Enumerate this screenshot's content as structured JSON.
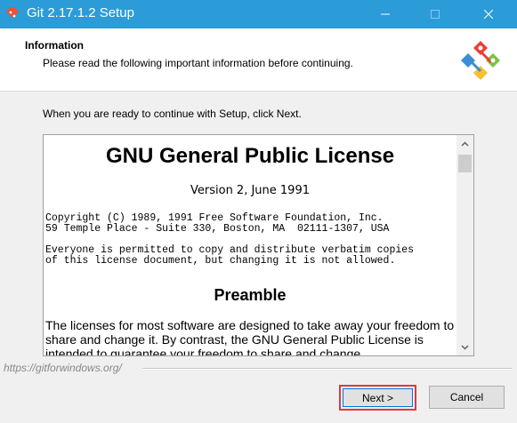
{
  "window": {
    "title": "Git 2.17.1.2 Setup"
  },
  "header": {
    "title": "Information",
    "subtitle": "Please read the following important information before continuing."
  },
  "intro": "When you are ready to continue with Setup, click Next.",
  "license": {
    "title": "GNU General Public License",
    "version": "Version 2, June 1991",
    "copyright_lines": [
      "Copyright (C) 1989, 1991 Free Software Foundation, Inc.",
      "59 Temple Place - Suite 330, Boston, MA  02111-1307, USA"
    ],
    "permission_lines": [
      "Everyone is permitted to copy and distribute verbatim copies",
      "of this license document, but changing it is not allowed."
    ],
    "preamble_heading": "Preamble",
    "preamble_text": "  The licenses for most software are designed to take away your freedom to share and change it. By contrast, the GNU General Public License is intended to guarantee your freedom to share and change"
  },
  "footer": {
    "link": "https://gitforwindows.org/"
  },
  "buttons": {
    "next": "Next >",
    "cancel": "Cancel"
  },
  "icons": {
    "app": "git-icon",
    "minimize": "minimize-icon",
    "maximize": "maximize-icon",
    "close": "close-icon",
    "logo": "git-logo-icon",
    "scroll_up": "scroll-up-icon",
    "scroll_down": "scroll-down-icon"
  },
  "colors": {
    "titlebar": "#2b9cd8",
    "highlight": "#e0393c",
    "focus": "#0078d7"
  }
}
